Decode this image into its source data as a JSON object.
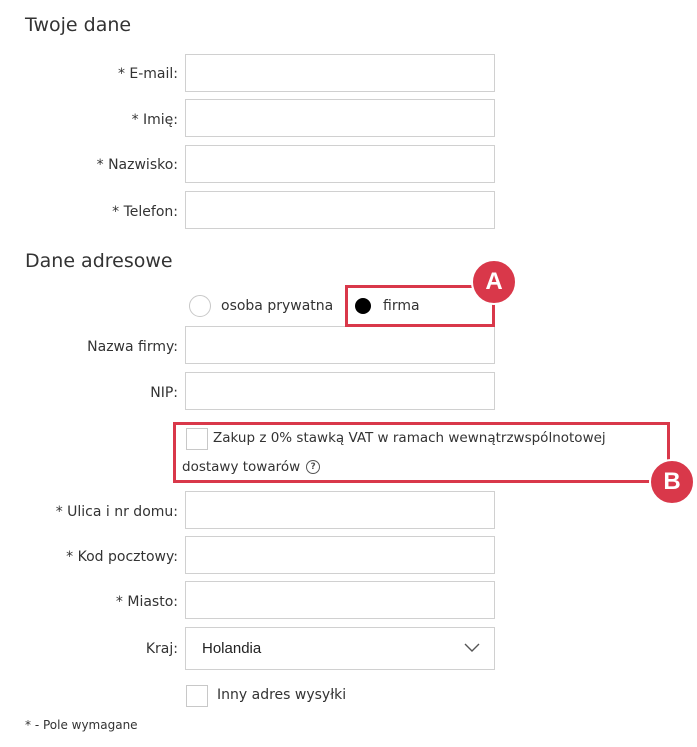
{
  "section_personal": {
    "title": "Twoje dane"
  },
  "personal_fields": {
    "email": {
      "label": "* E-mail:",
      "value": ""
    },
    "first_name": {
      "label": "* Imię:",
      "value": ""
    },
    "last_name": {
      "label": "* Nazwisko:",
      "value": ""
    },
    "phone": {
      "label": "* Telefon:",
      "value": ""
    }
  },
  "section_address": {
    "title": "Dane adresowe"
  },
  "customer_type": {
    "options": [
      "osoba prywatna",
      "firma"
    ],
    "selected": "firma"
  },
  "company_fields": {
    "company_name": {
      "label": "Nazwa firmy:",
      "value": ""
    },
    "nip": {
      "label": "NIP:",
      "value": ""
    }
  },
  "vat_checkbox": {
    "line1": "Zakup z 0% stawką VAT w ramach wewnątrzwspólnotowej",
    "line2": "dostawy towarów",
    "checked": false,
    "help_icon": "?"
  },
  "address_fields": {
    "street": {
      "label": "* Ulica i nr domu:",
      "value": ""
    },
    "postal_code": {
      "label": "* Kod pocztowy:",
      "value": ""
    },
    "city": {
      "label": "* Miasto:",
      "value": ""
    },
    "country": {
      "label": "Kraj:",
      "value": "Holandia"
    }
  },
  "other_shipping": {
    "label": "Inny adres wysyłki",
    "checked": false
  },
  "required_note": "* - Pole wymagane",
  "annotations": {
    "marker_a": "A",
    "marker_b": "B",
    "color": "#d9384a"
  },
  "icons": {
    "dropdown": "chevron-down-icon",
    "help": "question-circle-icon"
  }
}
